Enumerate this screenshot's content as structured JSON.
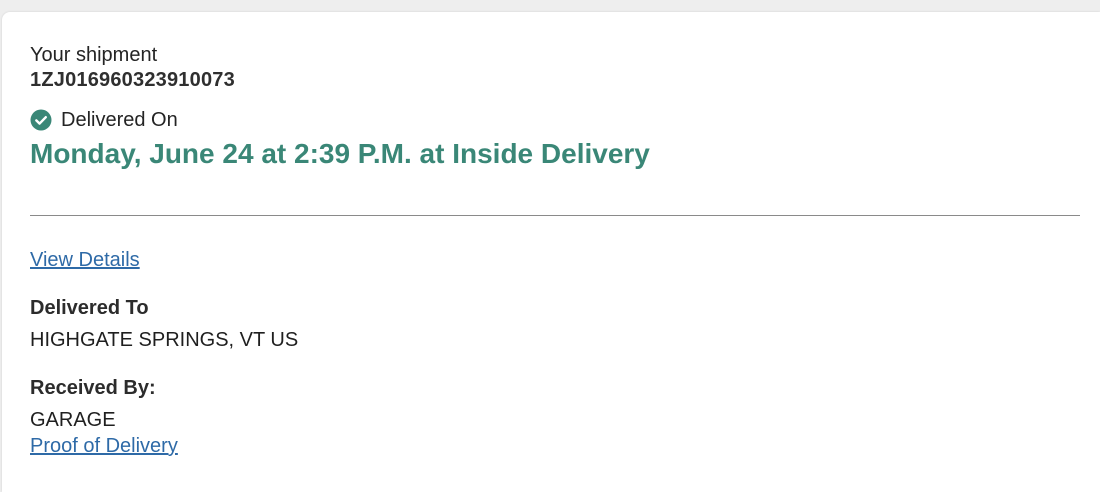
{
  "shipment": {
    "label": "Your shipment",
    "tracking_number": "1ZJ016960323910073"
  },
  "status": {
    "icon": "check-circle-icon",
    "label": "Delivered On",
    "date_text": "Monday, June 24 at 2:39 P.M. at Inside Delivery",
    "color": "#3a8777"
  },
  "links": {
    "view_details": "View Details",
    "proof_of_delivery": "Proof of Delivery",
    "color": "#2e6aa7"
  },
  "delivered_to": {
    "label": "Delivered To",
    "value": "HIGHGATE SPRINGS, VT US"
  },
  "received_by": {
    "label": "Received By:",
    "value": "GARAGE"
  }
}
